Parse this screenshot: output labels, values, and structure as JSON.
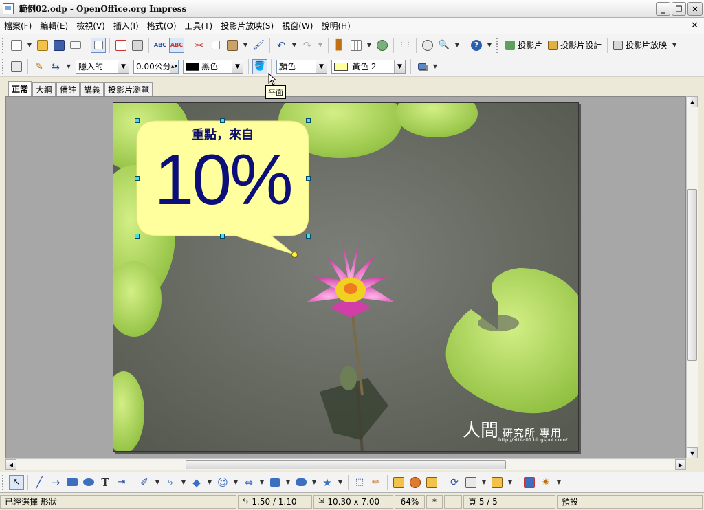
{
  "window": {
    "title": "範例02.odp - OpenOffice.org Impress"
  },
  "menu": [
    "檔案(F)",
    "編輯(E)",
    "檢視(V)",
    "插入(I)",
    "格式(O)",
    "工具(T)",
    "投影片放映(S)",
    "視窗(W)",
    "說明(H)"
  ],
  "toolbar1": {
    "slide_label": "投影片",
    "slide_design_label": "投影片設計",
    "slideshow_label": "投影片放映"
  },
  "toolbar2": {
    "line_style": "隱入的",
    "line_width": "0.00公分",
    "line_color_name": "黑色",
    "area_style": "顏色",
    "area_color_name": "黃色 2",
    "tooltip": "平面"
  },
  "tabs": [
    "正常",
    "大綱",
    "備註",
    "講義",
    "投影片瀏覽"
  ],
  "slide": {
    "callout_title": "重點，來自",
    "callout_big": "10%",
    "watermark_big": "人間",
    "watermark_small": "研究所 專用",
    "watermark_url": "http://attila01.blogspot.com/"
  },
  "status": {
    "selection": "已經選擇 形狀",
    "position": "1.50 / 1.10",
    "size": "10.30 x 7.00",
    "zoom": "64%",
    "modified": "*",
    "page": "頁 5 / 5",
    "layout": "預設"
  },
  "colors": {
    "callout_fill": "#ffff9e",
    "callout_text": "#0c0e7a",
    "handle": "#40e0e8"
  }
}
